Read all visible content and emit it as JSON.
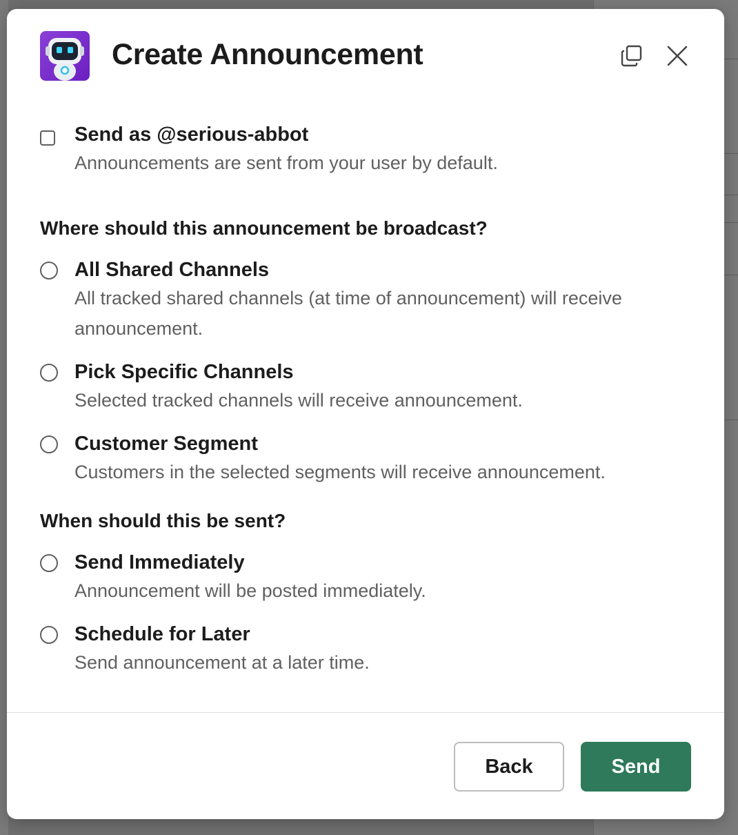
{
  "modal": {
    "title": "Create Announcement",
    "avatar_icon": "robot-avatar-icon",
    "popout_icon": "popout-icon",
    "close_icon": "close-icon"
  },
  "send_as": {
    "label": "Send as @serious-abbot",
    "description": "Announcements are sent from your user by default.",
    "checked": false
  },
  "broadcast": {
    "question": "Where should this announcement be broadcast?",
    "options": [
      {
        "label": "All Shared Channels",
        "description": "All tracked shared channels (at time of announcement) will receive announcement."
      },
      {
        "label": "Pick Specific Channels",
        "description": "Selected tracked channels will receive announcement."
      },
      {
        "label": "Customer Segment",
        "description": "Customers in the selected segments will receive announcement."
      }
    ]
  },
  "timing": {
    "question": "When should this be sent?",
    "options": [
      {
        "label": "Send Immediately",
        "description": "Announcement will be posted immediately."
      },
      {
        "label": "Schedule for Later",
        "description": "Send announcement at a later time."
      }
    ]
  },
  "footer": {
    "back_label": "Back",
    "send_label": "Send",
    "send_color": "#2e7a5a"
  }
}
